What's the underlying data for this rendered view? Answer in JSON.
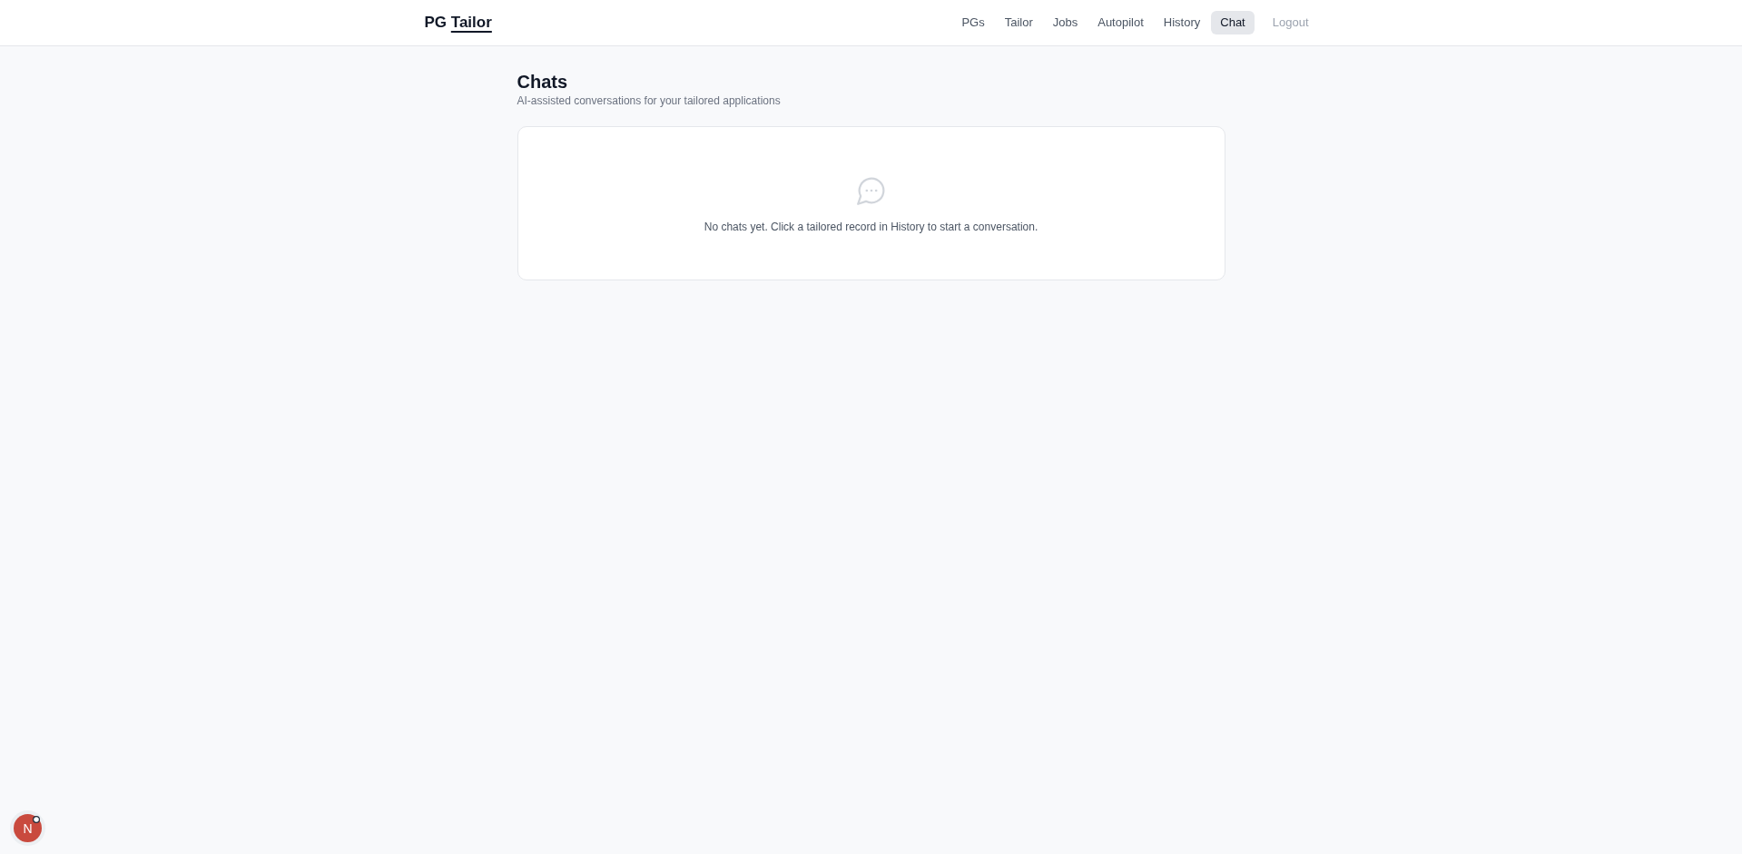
{
  "header": {
    "logo": {
      "plain": "PG",
      "underlined": "Tailor"
    },
    "nav": [
      {
        "label": "PGs",
        "selected": false
      },
      {
        "label": "Tailor",
        "selected": false
      },
      {
        "label": "Jobs",
        "selected": false
      },
      {
        "label": "Autopilot",
        "selected": false
      },
      {
        "label": "History",
        "selected": false
      },
      {
        "label": "Chat",
        "selected": true
      }
    ],
    "logout": "Logout"
  },
  "page": {
    "title": "Chats",
    "subtitle": "AI-assisted conversations for your tailored applications"
  },
  "empty_state": {
    "message": "No chats yet. Click a tailored record in History to start a conversation."
  },
  "dev_badge": {
    "label": "N"
  }
}
